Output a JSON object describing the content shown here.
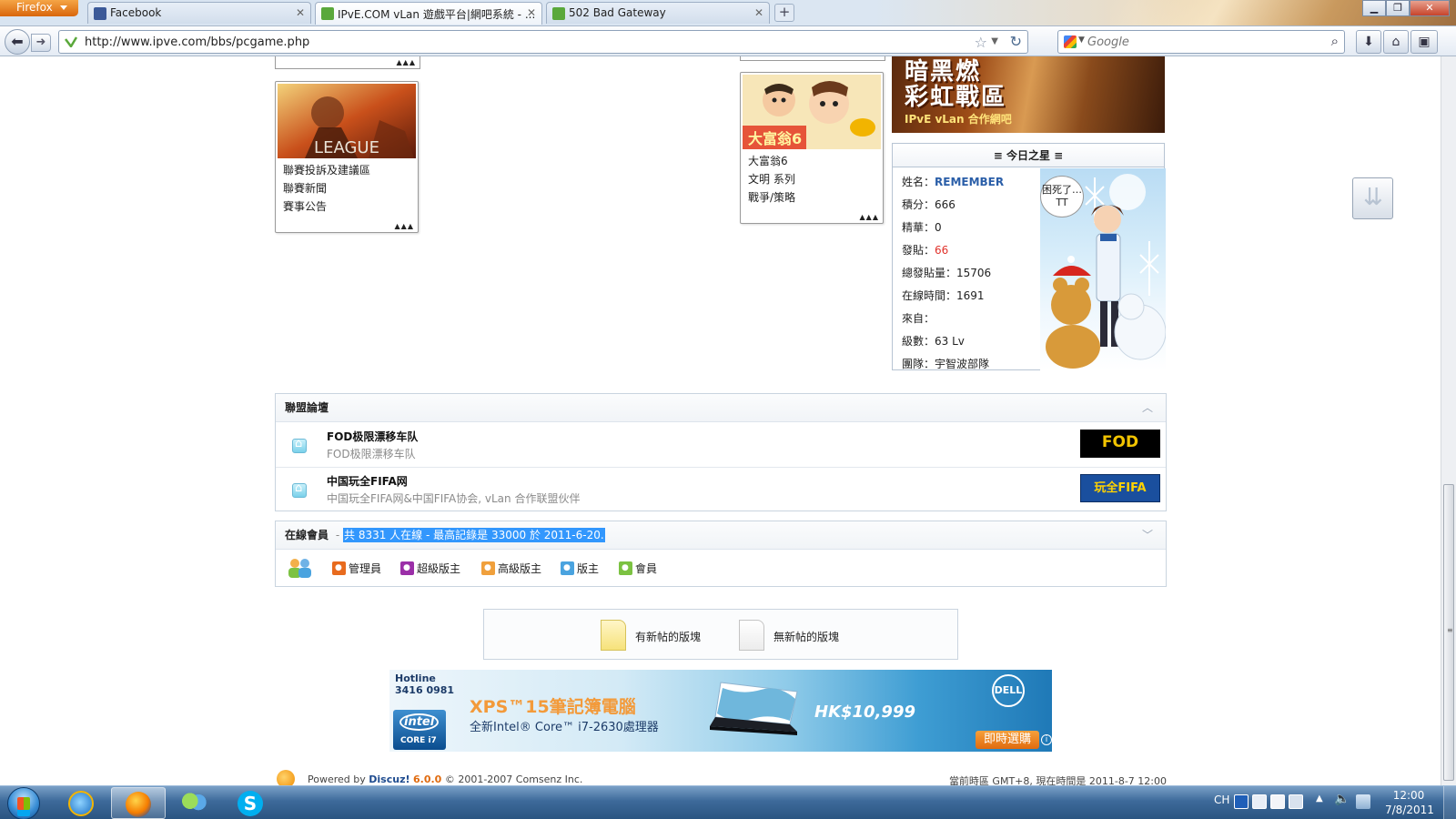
{
  "browser": {
    "menu_button": "Firefox",
    "tabs": [
      {
        "title": "Facebook",
        "active": false,
        "favicon_color": "#3b5998"
      },
      {
        "title": "IPvE.COM vLan 遊戲平台|網吧系統 - ...",
        "active": true,
        "favicon_color": "#5aa83b"
      },
      {
        "title": "502 Bad Gateway",
        "active": false,
        "favicon_color": "#5aa83b"
      }
    ],
    "new_tab": "+",
    "url": "http://www.ipve.com/bbs/pcgame.php",
    "search_engine": "Google",
    "search_placeholder": "Google"
  },
  "games": {
    "league": {
      "image_label": "LEAGUE",
      "items": [
        "聯賽投訴及建議區",
        "聯賽新聞",
        "賽事公告"
      ]
    },
    "richman": {
      "image_label": "大富翁6",
      "items": [
        "大富翁6",
        "文明 系列",
        "戰爭/策略"
      ]
    },
    "more": "▲▲▲"
  },
  "banner": {
    "line1": "暗黑燃",
    "line2": "彩虹戰區",
    "line3": "IPvE vLan 合作網吧"
  },
  "star": {
    "title": "≡ 今日之星 ≡",
    "bubble": "困死了…TT",
    "rows": [
      {
        "label": "姓名：",
        "value": "REMEMBER",
        "style": "blue"
      },
      {
        "label": "積分：",
        "value": "666",
        "style": ""
      },
      {
        "label": "精華：",
        "value": "0",
        "style": ""
      },
      {
        "label": "發貼：",
        "value": "66",
        "style": "red"
      },
      {
        "label": "總發貼量：",
        "value": "15706",
        "style": ""
      },
      {
        "label": "在線時間：",
        "value": "1691",
        "style": ""
      },
      {
        "label": "來自：",
        "value": "",
        "style": ""
      },
      {
        "label": "級數：",
        "value": "63 Lv",
        "style": ""
      },
      {
        "label": "團隊：",
        "value": "宇智波部隊",
        "style": ""
      }
    ]
  },
  "alliance": {
    "title": "聯盟論壇",
    "forums": [
      {
        "name": "FOD极限漂移车队",
        "desc": "FOD极限漂移车队",
        "logo": "FOD",
        "logo_bg": "#000000",
        "logo_fg": "#f2c400"
      },
      {
        "name": "中国玩全FIFA网",
        "desc": "中国玩全FIFA网&中国FIFA协会, vLan 合作联盟伙伴",
        "logo": "玩全FIFA",
        "logo_bg": "#1a4f9e",
        "logo_fg": "#ffd200"
      }
    ]
  },
  "online": {
    "title": "在線會員",
    "sep": "-",
    "summary": "共 8331 人在線 - 最高記錄是 33000 於 2011-6-20.",
    "legend": [
      {
        "label": "管理員",
        "color": "#e86b1e"
      },
      {
        "label": "超級版主",
        "color": "#9b2fa8"
      },
      {
        "label": "高級版主",
        "color": "#f0a03c"
      },
      {
        "label": "版主",
        "color": "#4aa3df"
      },
      {
        "label": "會員",
        "color": "#7cc242"
      }
    ]
  },
  "legend_box": {
    "has_new": "有新帖的版塊",
    "no_new": "無新帖的版塊"
  },
  "ad": {
    "hotline_label": "Hotline",
    "hotline_number": "3416 0981",
    "intel_brand": "intel",
    "intel_cpu": "CORE i7",
    "title": "XPS™15筆記簿電腦",
    "subtitle": "全新Intel® Core™ i7-2630處理器",
    "price": "HK$10,999",
    "brand": "DELL",
    "buy": "即時選購",
    "info": "i"
  },
  "footer": {
    "powered": "Powered by",
    "discuz": "Discuz!",
    "version": "6.0.0",
    "copyright": "© 2001-2007 Comsenz Inc.",
    "time": "當前時區 GMT+8, 現在時間是 2011-8-7 12:00"
  },
  "taskbar": {
    "ime": "CH",
    "clock_time": "12:00",
    "clock_date": "7/8/2011"
  }
}
